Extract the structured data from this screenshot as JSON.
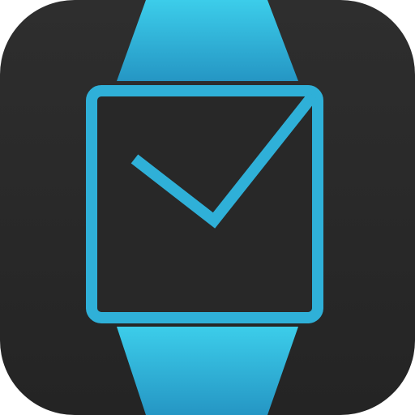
{
  "icon": {
    "name": "smartwatch-checkmark-icon",
    "background_color": "#282828",
    "accent_color": "#2fb0d8",
    "accent_highlight": "#3ccdea",
    "accent_shadow": "#2596c4"
  }
}
